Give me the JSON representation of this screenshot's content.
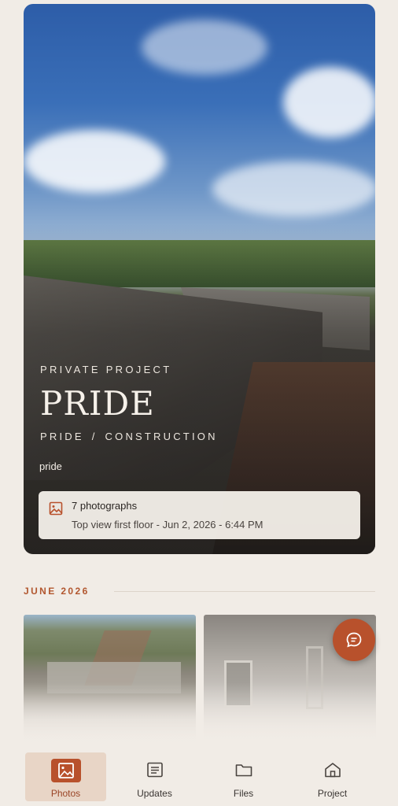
{
  "hero": {
    "eyebrow": "PRIVATE PROJECT",
    "title": "PRIDE",
    "crumb_project": "PRIDE",
    "crumb_sep": "/",
    "crumb_category": "CONSTRUCTION",
    "description": "pride",
    "card": {
      "icon": "image-icon",
      "count_label": "7 photographs",
      "caption": "Top view first floor - Jun 2, 2026 - 6:44 PM"
    }
  },
  "section": {
    "month": "JUNE 2026"
  },
  "fab": {
    "icon": "chat-icon"
  },
  "nav": {
    "items": [
      {
        "label": "Photos",
        "icon": "photo-icon",
        "active": true
      },
      {
        "label": "Updates",
        "icon": "list-icon",
        "active": false
      },
      {
        "label": "Files",
        "icon": "folder-icon",
        "active": false
      },
      {
        "label": "Project",
        "icon": "home-icon",
        "active": false
      }
    ]
  },
  "colors": {
    "accent": "#b8512c",
    "background": "#f1ece6",
    "active_tab_bg": "#e8d5c6"
  }
}
